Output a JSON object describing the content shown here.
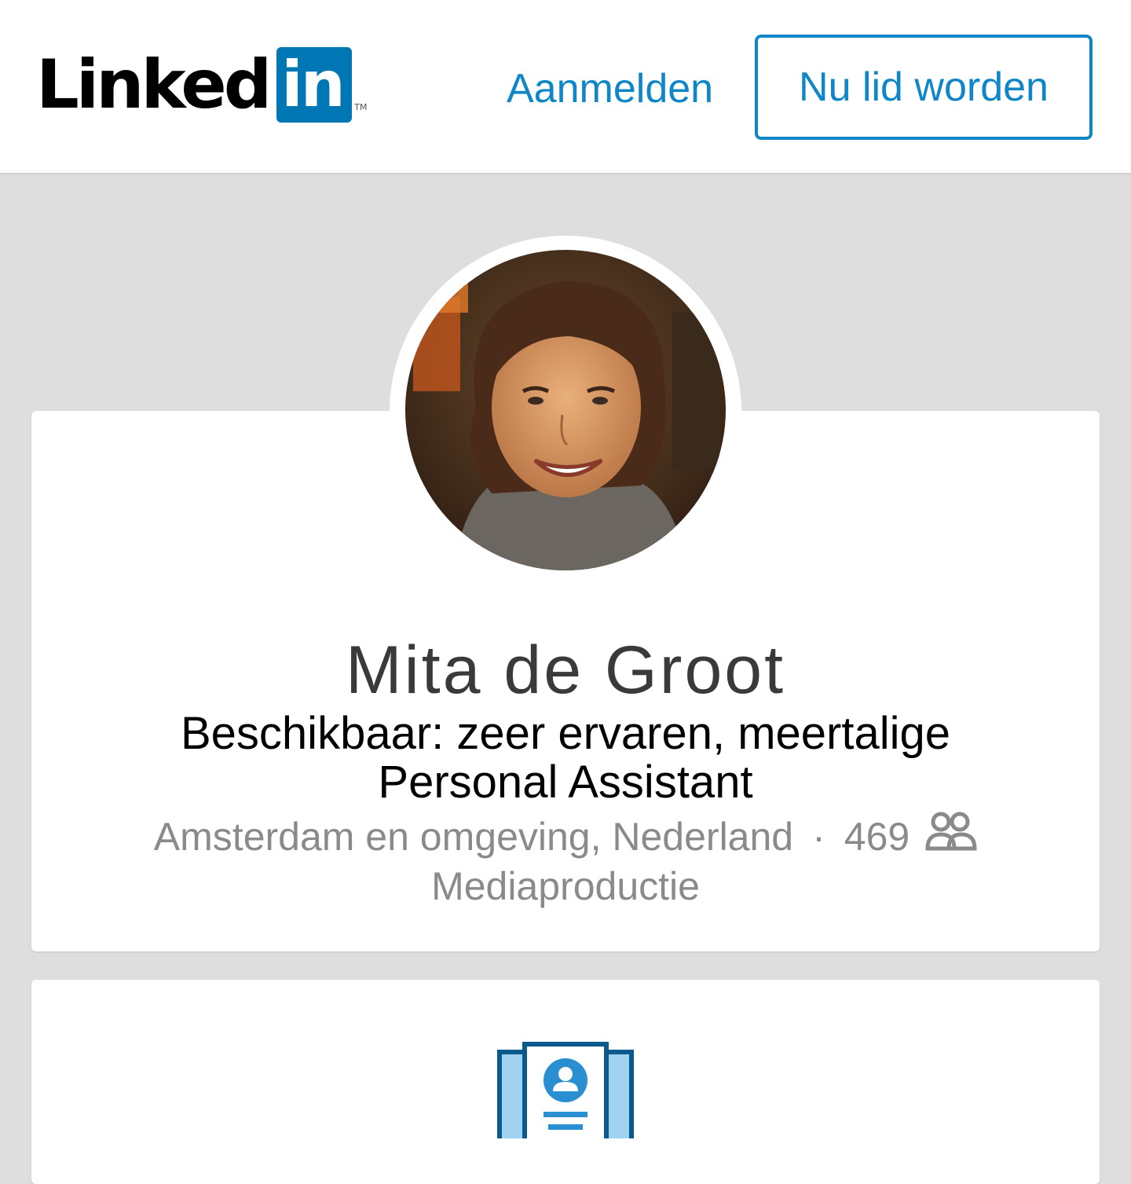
{
  "header": {
    "logo_text": "Linked",
    "logo_box_text": "in",
    "logo_tm": "TM",
    "signin_label": "Aanmelden",
    "join_label": "Nu lid worden"
  },
  "profile": {
    "name": "Mita de Groot",
    "headline": "Beschikbaar: zeer ervaren, meertalige Personal Assistant",
    "location": "Amsterdam en omgeving, Nederland",
    "separator": "·",
    "connections": "469",
    "industry": "Mediaproductie"
  },
  "icons": {
    "connections": "connections-icon",
    "profile_card": "profile-card-icon"
  },
  "colors": {
    "brand": "#0077b5",
    "link": "#0e86c8",
    "background": "#dedede"
  }
}
